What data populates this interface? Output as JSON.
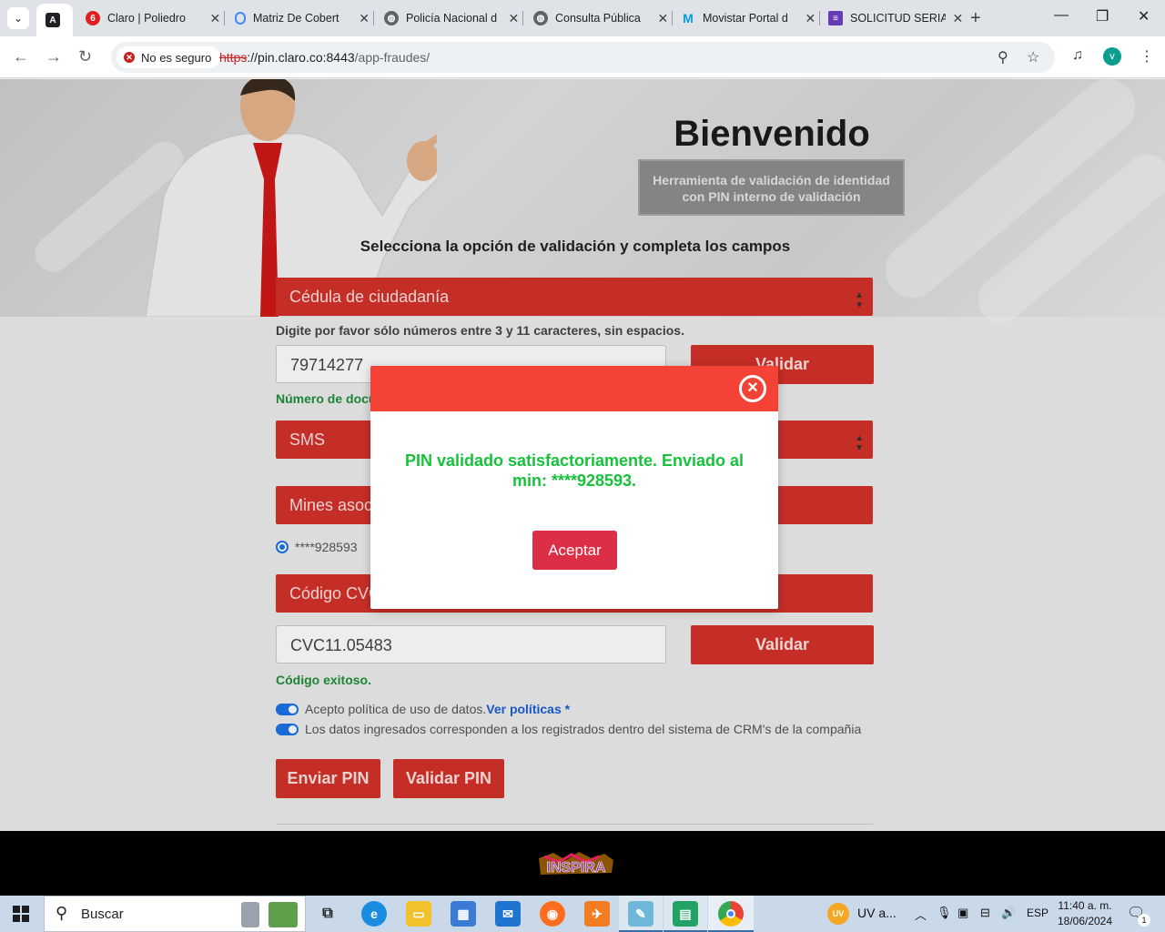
{
  "browser": {
    "tabs": [
      {
        "title": "",
        "favicon": "angular-icon",
        "active": true
      },
      {
        "title": "Claro | Poliedro",
        "favicon": "claro-icon"
      },
      {
        "title": "Matriz De Cobert",
        "favicon": "google-drive-icon"
      },
      {
        "title": "Policía Nacional d",
        "favicon": "globe-icon"
      },
      {
        "title": "Consulta Pública",
        "favicon": "globe-icon"
      },
      {
        "title": "Movistar Portal d",
        "favicon": "movistar-icon"
      },
      {
        "title": "SOLICITUD SERIA",
        "favicon": "google-forms-icon"
      }
    ],
    "security_chip": "No es seguro",
    "url_scheme": "https",
    "url_host": "://pin.claro.co:8443",
    "url_path": "/app-fraudes/",
    "profile_initial": "v"
  },
  "hero": {
    "title": "Bienvenido",
    "subtitle_line1": "Herramienta de validación de identidad",
    "subtitle_line2": "con PIN interno de validación"
  },
  "form": {
    "instructions": "Selecciona la opción de validación y completa los campos",
    "document_type": "Cédula de ciudadanía",
    "document_hint": "Digite por favor sólo números entre 3 y 11 caracteres, sin espacios.",
    "document_number": "79714277",
    "validate_label": "Validar",
    "document_status": "Número de docu",
    "channel": "SMS",
    "mines_placeholder": "Mines asoc",
    "min_option": "****928593",
    "cvc_placeholder": "Código CVC",
    "cvc_value": "CVC11.05483",
    "cvc_status": "Código exitoso.",
    "policy_text": "Acepto política de uso de datos.",
    "policy_link": "Ver políticas *",
    "crm_text": "Los datos ingresados corresponden a los registrados dentro del sistema de CRM's de la compañia",
    "send_pin_label": "Enviar PIN",
    "validate_pin_label": "Validar PIN"
  },
  "modal": {
    "message_line1": "PIN validado satisfactoriamente. Enviado al",
    "message_line2": "min: ****928593.",
    "accept_label": "Aceptar"
  },
  "footer": {
    "logo_text": "INSPIRA"
  },
  "taskbar": {
    "search_placeholder": "Buscar",
    "uv_label": "UV a...",
    "language": "ESP",
    "time": "11:40 a. m.",
    "date": "18/06/2024",
    "notification_count": "1"
  },
  "colors": {
    "accent_red": "#d4322b",
    "modal_header": "#f44336",
    "success_green": "#16c23a",
    "accept_button": "#dc2f45"
  }
}
